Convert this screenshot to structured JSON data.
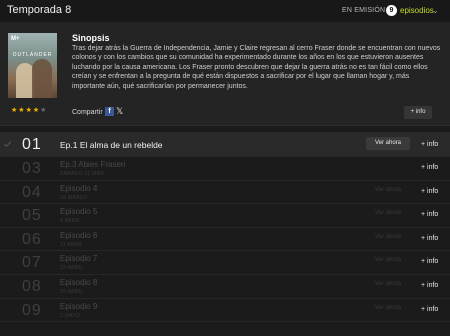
{
  "header": {
    "season_title": "Temporada 8",
    "status": "EN EMISIÓN",
    "episode_count": "9",
    "episodes_label": "episodios",
    "chevron_icon": "chevron-down-icon"
  },
  "synopsis": {
    "poster": {
      "logo": "M+",
      "title": "OUTLANDER"
    },
    "rating": {
      "value": 3.5,
      "max": 5
    },
    "title": "Sinopsis",
    "text": "Tras dejar atrás la Guerra de Independencia, Jamie y Claire regresan al cerro Fraser donde se encuentran con nuevos colonos y con los cambios que su comunidad ha experimentado durante los años en los que estuvieron ausentes luchando por la causa americana. Los Fraser pronto descubren que dejar la guerra atrás no es tan fácil como ellos creían y se enfrentan a la pregunta de qué están dispuestos a sacrificar por el lugar que llaman hogar y, más importante aún, qué sacrificarían por permanecer juntos.",
    "share_label": "Compartir",
    "facebook_icon": "f",
    "x_icon": "𝕏",
    "info_label": "+ info"
  },
  "episodes": [
    {
      "number": "01",
      "title": "Ep.1 El alma de un rebelde",
      "date": "",
      "watch_label": "Ver ahora",
      "info_label": "+ info",
      "active": true
    },
    {
      "number": "03",
      "title": "Ep.3 Abies Fraseri",
      "date": "SÁBADO 21 MAR",
      "watch_label": "",
      "info_label": "+ info",
      "active": false
    },
    {
      "number": "04",
      "title": "Episodio 4",
      "date": "28 MARZO",
      "watch_label": "Ver ahora",
      "info_label": "+ info",
      "active": false
    },
    {
      "number": "05",
      "title": "Episodio 5",
      "date": "4 ABRIL",
      "watch_label": "Ver ahora",
      "info_label": "+ info",
      "active": false
    },
    {
      "number": "06",
      "title": "Episodio 6",
      "date": "11 ABRIL",
      "watch_label": "Ver ahora",
      "info_label": "+ info",
      "active": false
    },
    {
      "number": "07",
      "title": "Episodio 7",
      "date": "18 ABRIL",
      "watch_label": "Ver ahora",
      "info_label": "+ info",
      "active": false
    },
    {
      "number": "08",
      "title": "Episodio 8",
      "date": "25 ABRIL",
      "watch_label": "Ver ahora",
      "info_label": "+ info",
      "active": false
    },
    {
      "number": "09",
      "title": "Episodio 9",
      "date": "2 MAYO",
      "watch_label": "Ver ahora",
      "info_label": "+ info",
      "active": false
    }
  ],
  "colors": {
    "accent": "#c8dc2c",
    "star": "#f5b301",
    "facebook": "#3b5998"
  }
}
